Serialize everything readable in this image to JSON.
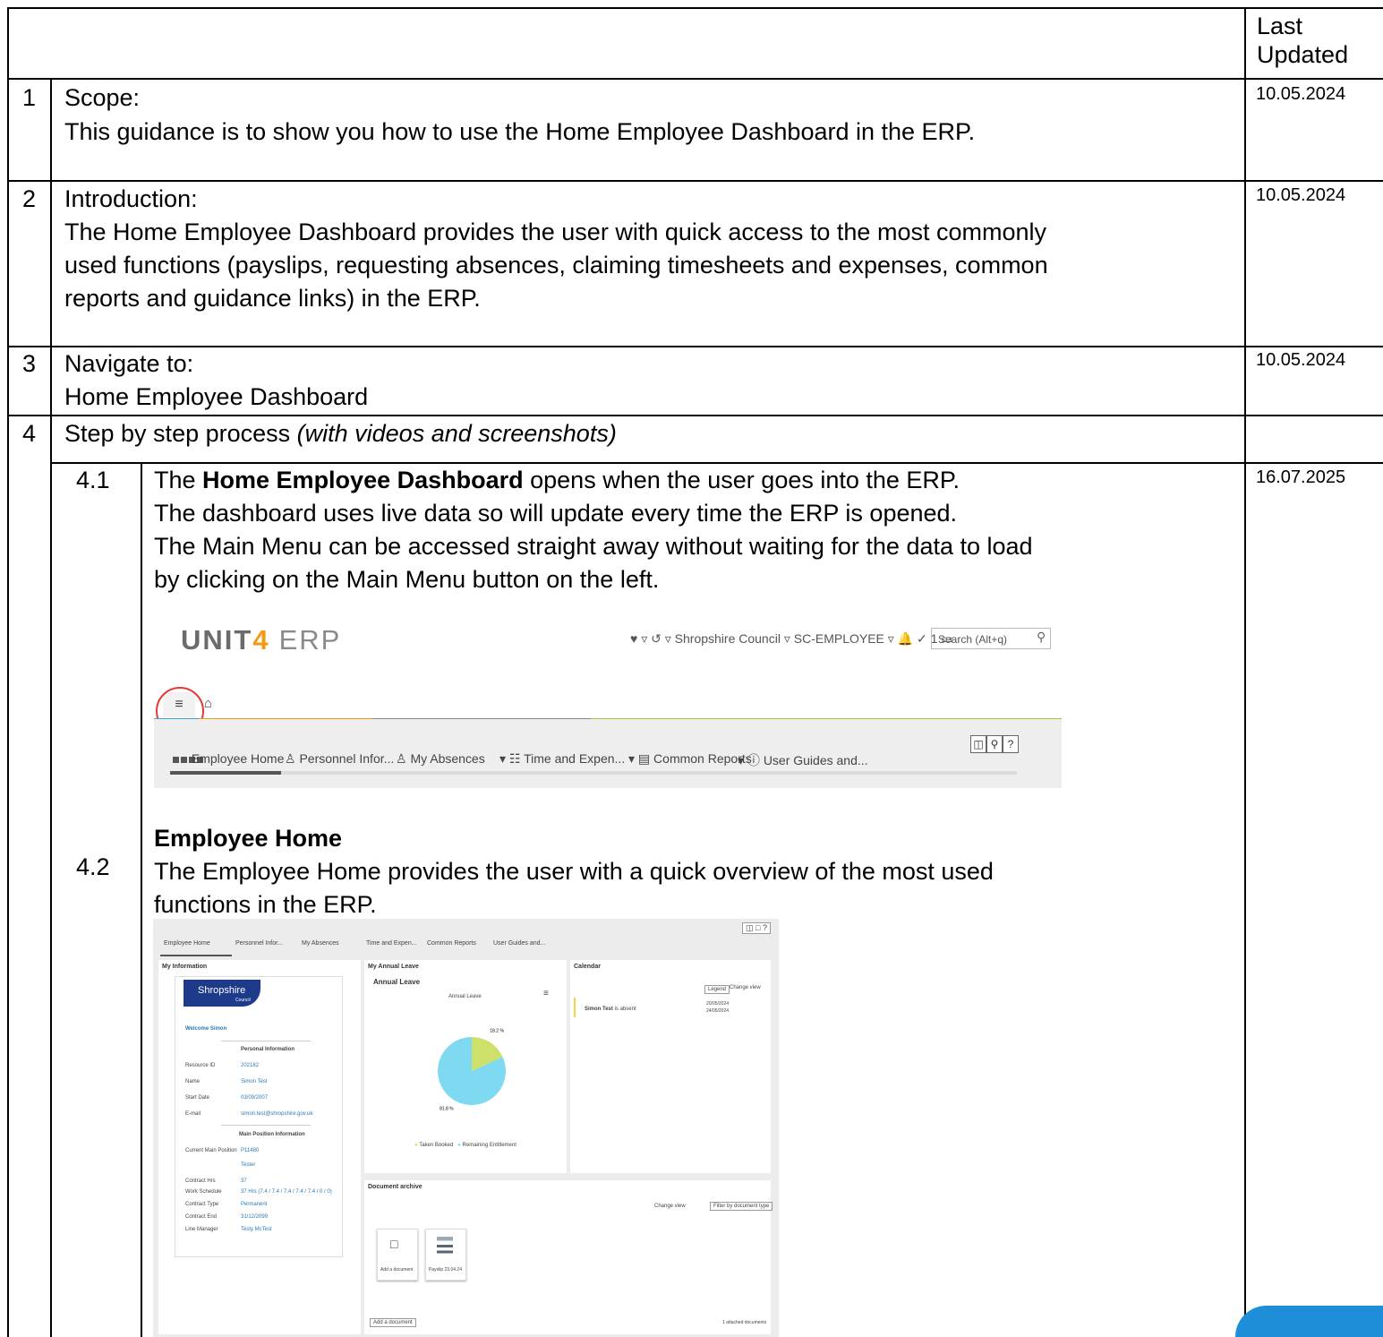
{
  "header": {
    "col3": "Last Updated"
  },
  "rows": [
    {
      "num": "1",
      "title": "Scope:",
      "body": "This guidance is to show you how to use the Home Employee Dashboard in the ERP.",
      "date": "10.05.2024"
    },
    {
      "num": "2",
      "title": "Introduction:",
      "body_lines": [
        "The Home Employee Dashboard provides the user with quick access to the most commonly",
        "used functions (payslips, requesting absences, claiming timesheets and expenses, common",
        "reports and guidance links) in the ERP."
      ],
      "date": "10.05.2024"
    },
    {
      "num": "3",
      "title": "Navigate to:",
      "body": "Home Employee Dashboard",
      "date": "10.05.2024"
    },
    {
      "num": "4",
      "title": "Step by step process ",
      "title_italic": "(with videos and screenshots)"
    }
  ],
  "step41": {
    "num": "4.1",
    "date": "16.07.2025",
    "line1_pre": "The ",
    "line1_bold": "Home Employee Dashboard",
    "line1_post": " opens when the user goes into the ERP.",
    "line2": "The dashboard uses live data so will update every time the ERP is opened.",
    "line3": "The Main Menu can be accessed straight away without waiting for the data to load",
    "line4": "by clicking on the Main Menu button on the left."
  },
  "screenshot1": {
    "logo_main": "UNIT",
    "logo_four": "4",
    "logo_erp": "ERP",
    "topbar": "♥ ▿  ↺ ▿   Shropshire Council  ▿   SC-EMPLOYEE ▿   🔔   ✓  1  ▭",
    "search_placeholder": "Search (Alt+q)",
    "menu": [
      "Employee Home",
      "Personnel Infor...",
      "My Absences",
      "Time and Expen...",
      "Common Reports",
      "User Guides and..."
    ]
  },
  "step42": {
    "num": "4.2",
    "heading": "Employee Home",
    "line1": "The Employee Home provides the user with a quick overview of the most used",
    "line2": "functions in the ERP."
  },
  "screenshot2": {
    "menu": [
      "Employee Home",
      "Personnel Infor...",
      "My Absences",
      "Time and Expen...",
      "Common Reports",
      "User Guides and..."
    ],
    "my_info_title": "My Information",
    "shropshire": "Shropshire",
    "council": "Council",
    "welcome": "Welcome Simon",
    "personal_info": "Personal Information",
    "fields": [
      {
        "label": "Resource ID",
        "value": "202182"
      },
      {
        "label": "Name",
        "value": "Simon Test"
      },
      {
        "label": "Start Date",
        "value": "03/09/2007"
      },
      {
        "label": "E-mail",
        "value": "simon.test@shropshire.gov.uk"
      }
    ],
    "main_position": "Main Position Information",
    "pos_fields": [
      {
        "label": "Current Main Position",
        "value": "P11480"
      },
      {
        "label": "",
        "value": "Tester"
      },
      {
        "label": "Contract Hrs",
        "value": "37"
      },
      {
        "label": "Work Schedule",
        "value": "37 Hrs (7.4 / 7.4 / 7.4 / 7.4 / 7.4 / 0 / 0)"
      },
      {
        "label": "Contract Type",
        "value": "Permanent"
      },
      {
        "label": "Contract End",
        "value": "31/12/2099"
      },
      {
        "label": "Line Manager",
        "value": "Testy McTest"
      }
    ],
    "annual_title": "My Annual Leave",
    "annual_sub": "Annual Leave",
    "chart_title": "Annual Leave",
    "chart_data": {
      "type": "pie",
      "title": "Annual Leave",
      "slices": [
        {
          "name": "Taken Booked",
          "value": 18.2,
          "label": "18.2 %",
          "color": "#cde06a"
        },
        {
          "name": "Remaining Entitlement",
          "value": 81.8,
          "label": "81.8 %",
          "color": "#7fd9f0"
        }
      ]
    },
    "calendar_title": "Calendar",
    "legend_btn": "Legend",
    "change_view": "Change view",
    "cal_entry_name": "Simon Test",
    "cal_entry_text": " is absent",
    "cal_date1": "20/05/2024",
    "cal_date2": "24/05/2024",
    "doc_title": "Document archive",
    "doc_change_view": "Change view",
    "doc_filter": "Filter by document type",
    "add_doc_tile": "Add a document",
    "payslip_tile": "Payslip 23.04.24",
    "add_doc_btn": "Add a document",
    "attached": "1 attached documents"
  }
}
